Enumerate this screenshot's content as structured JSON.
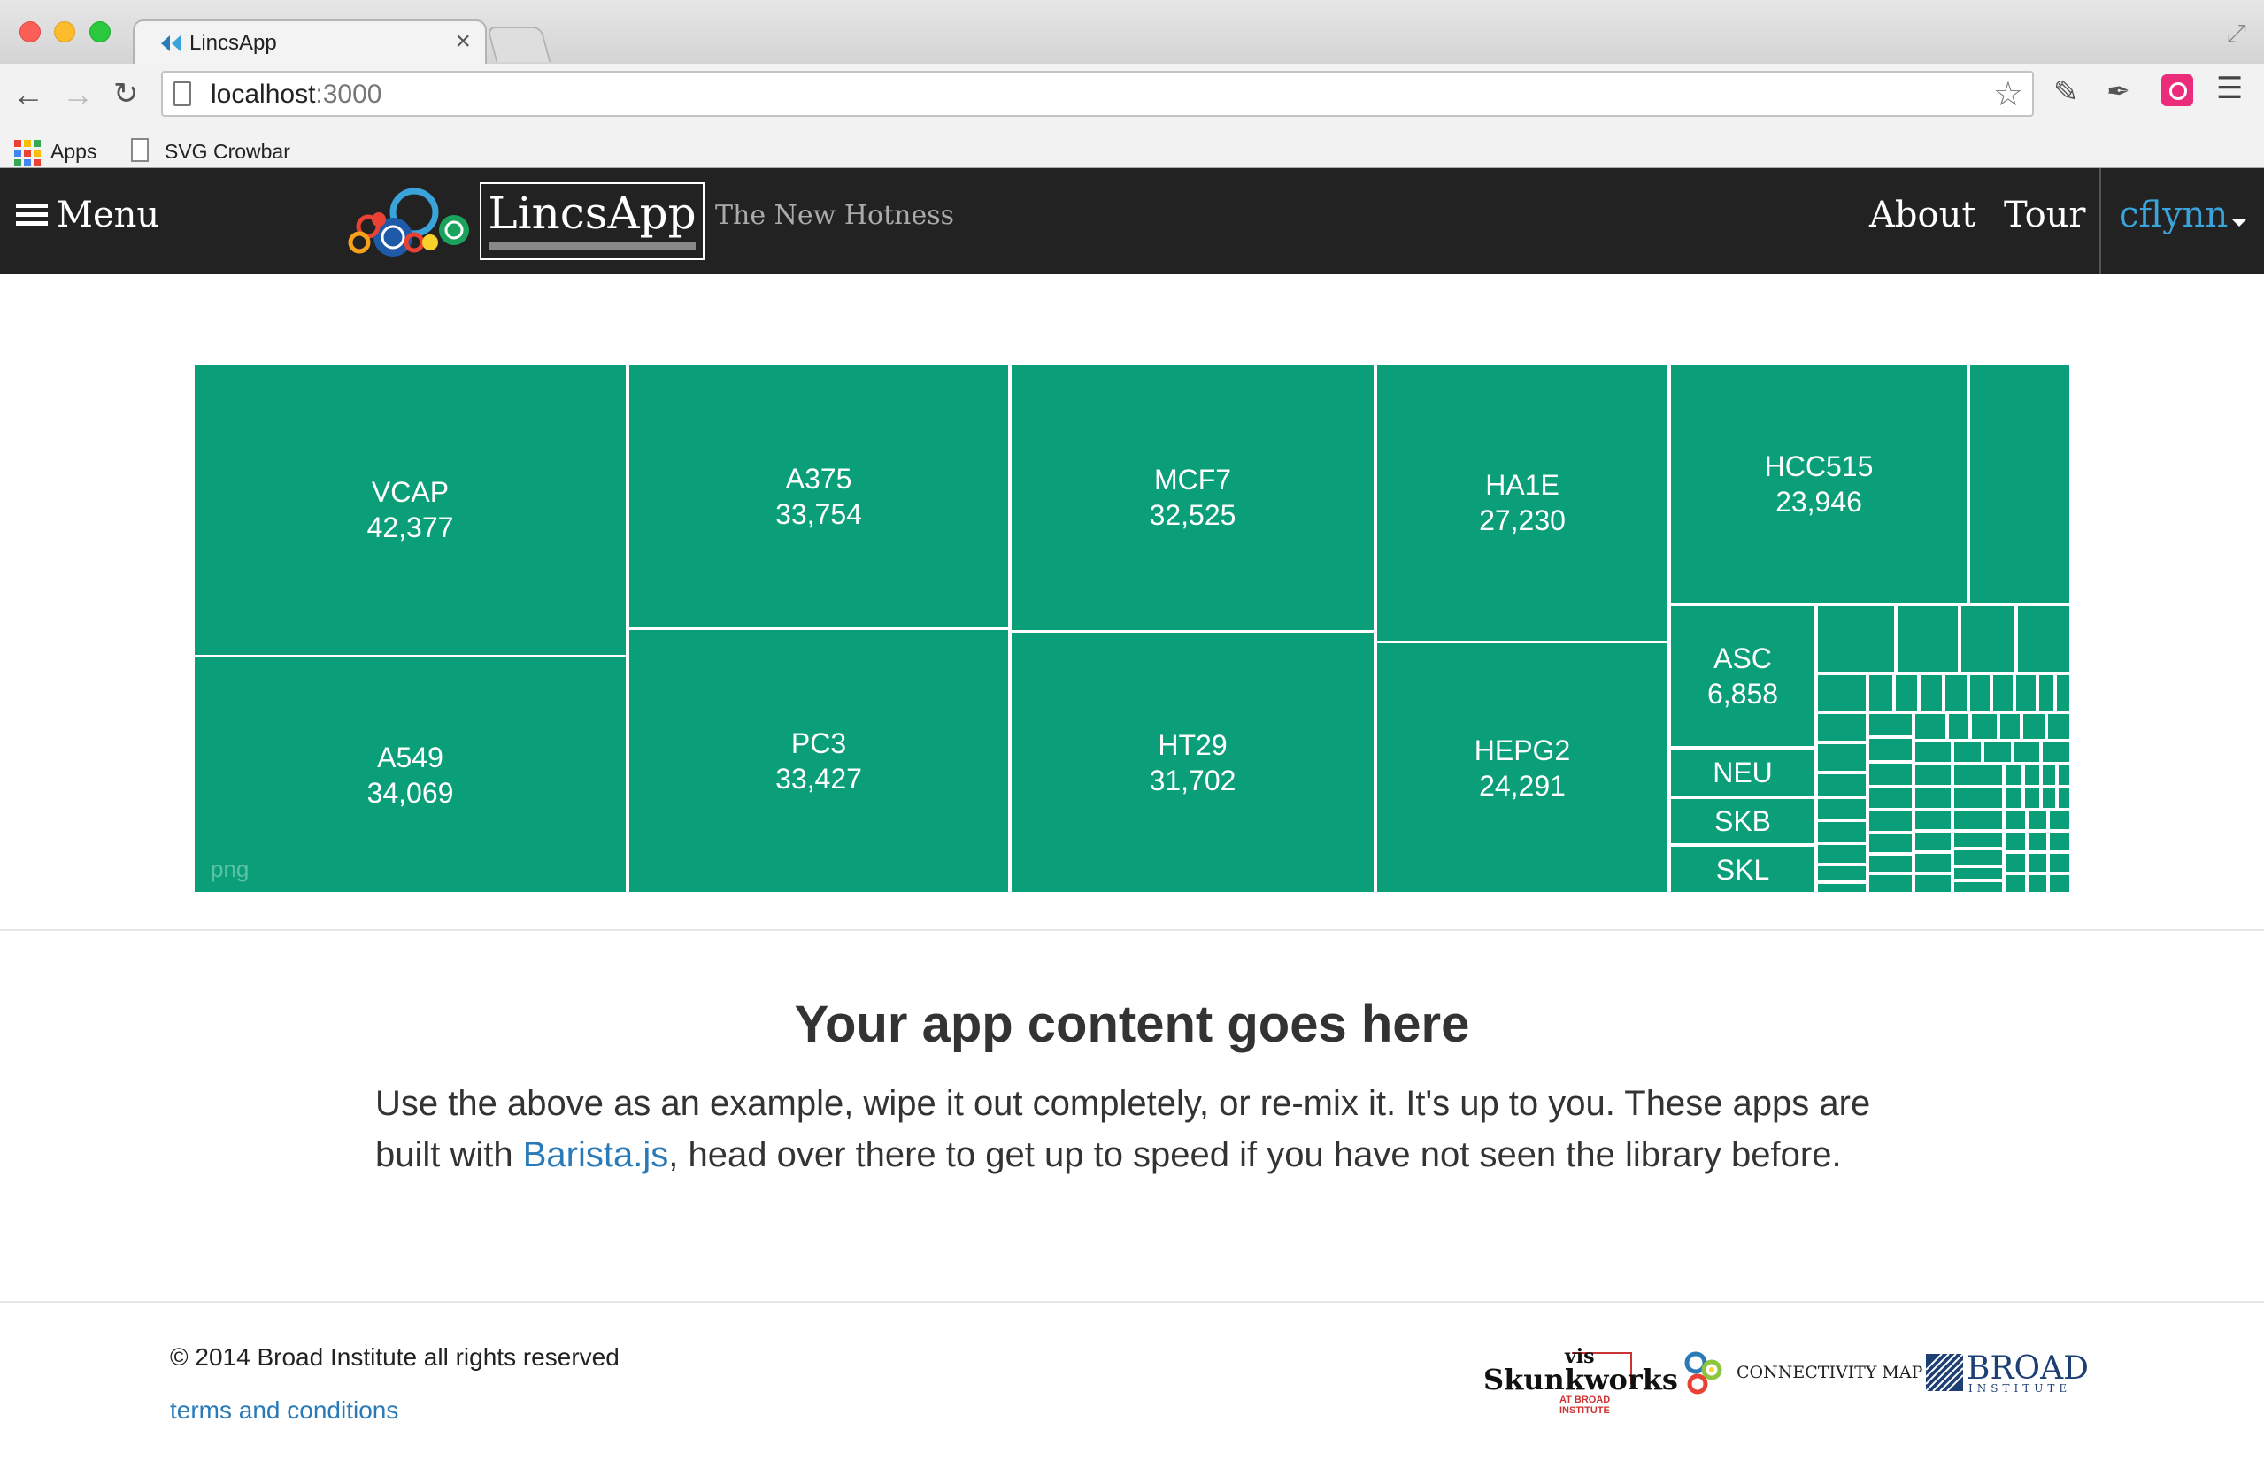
{
  "browser": {
    "tab_title": "LincsApp",
    "tab_close": "×",
    "url_host": "localhost",
    "url_port": ":3000",
    "bookmarks": [
      {
        "label": "Apps",
        "icon": "apps-grid-icon"
      },
      {
        "label": "SVG Crowbar",
        "icon": "file-icon"
      }
    ]
  },
  "navbar": {
    "menu_label": "Menu",
    "brand": "LincsApp",
    "tagline": "The New Hotness",
    "links": [
      "About",
      "Tour"
    ],
    "user": "cflynn",
    "colors": {
      "background": "#222222",
      "user": "#3aa3d9"
    }
  },
  "treemap": {
    "export_label": "png",
    "color": "#0a9f78",
    "cells": [
      {
        "name": "VCAP",
        "value": "42,377"
      },
      {
        "name": "A549",
        "value": "34,069"
      },
      {
        "name": "A375",
        "value": "33,754"
      },
      {
        "name": "PC3",
        "value": "33,427"
      },
      {
        "name": "MCF7",
        "value": "32,525"
      },
      {
        "name": "HT29",
        "value": "31,702"
      },
      {
        "name": "HA1E",
        "value": "27,230"
      },
      {
        "name": "HEPG2",
        "value": "24,291"
      },
      {
        "name": "HCC515",
        "value": "23,946"
      },
      {
        "name": "ASC",
        "value": "6,858"
      },
      {
        "name": "NEU",
        "value": ""
      },
      {
        "name": "SKB",
        "value": ""
      },
      {
        "name": "SKL",
        "value": ""
      }
    ]
  },
  "content": {
    "heading": "Your app content goes here",
    "body_before": "Use the above as an example, wipe it out completely, or re-mix it. It's up to you. These apps are built with ",
    "link": "Barista.js",
    "body_after": ", head over there to get up to speed if you have not seen the library before."
  },
  "footer": {
    "copyright": "© 2014 Broad Institute all rights reserved",
    "terms": "terms and conditions",
    "logos": {
      "vis_top": "vis",
      "vis_main": "Skunkworks",
      "vis_sub": "AT BROAD INSTITUTE",
      "cmap": "CONNECTIVITY MAP",
      "broad": "BROAD",
      "broad_sub": "INSTITUTE"
    }
  }
}
